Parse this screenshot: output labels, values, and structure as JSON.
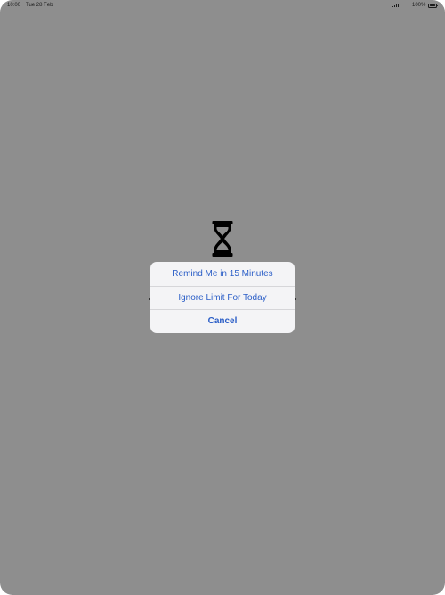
{
  "status_bar": {
    "time": "10:00",
    "date": "Tue 28 Feb",
    "battery_percent": "100%",
    "battery_level": 1.0,
    "signal_bars": 4
  },
  "center_icon": "hourglass-icon",
  "action_sheet": {
    "items": [
      {
        "label": "Remind Me in 15 Minutes"
      },
      {
        "label": "Ignore Limit For Today"
      },
      {
        "label": "Cancel"
      }
    ]
  },
  "colors": {
    "backdrop": "#8e8e8e",
    "sheet_background": "#f4f4f6",
    "action_text": "#2b5ec7",
    "separator": "#d6d6d9",
    "icon": "#000000"
  }
}
